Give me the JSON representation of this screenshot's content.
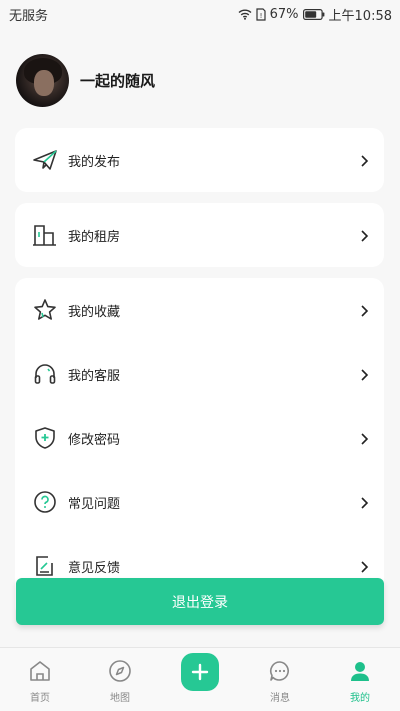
{
  "status_bar": {
    "carrier": "无服务",
    "battery": "67%",
    "time": "上午10:58"
  },
  "profile": {
    "username": "一起的随风"
  },
  "menu": {
    "publish": "我的发布",
    "rental": "我的租房",
    "favorites": "我的收藏",
    "service": "我的客服",
    "password": "修改密码",
    "faq": "常见问题",
    "feedback": "意见反馈"
  },
  "logout_label": "退出登录",
  "tabbar": {
    "home": "首页",
    "map": "地图",
    "messages": "消息",
    "mine": "我的"
  },
  "colors": {
    "accent": "#26c894",
    "active_tab": "#1ec08b"
  }
}
